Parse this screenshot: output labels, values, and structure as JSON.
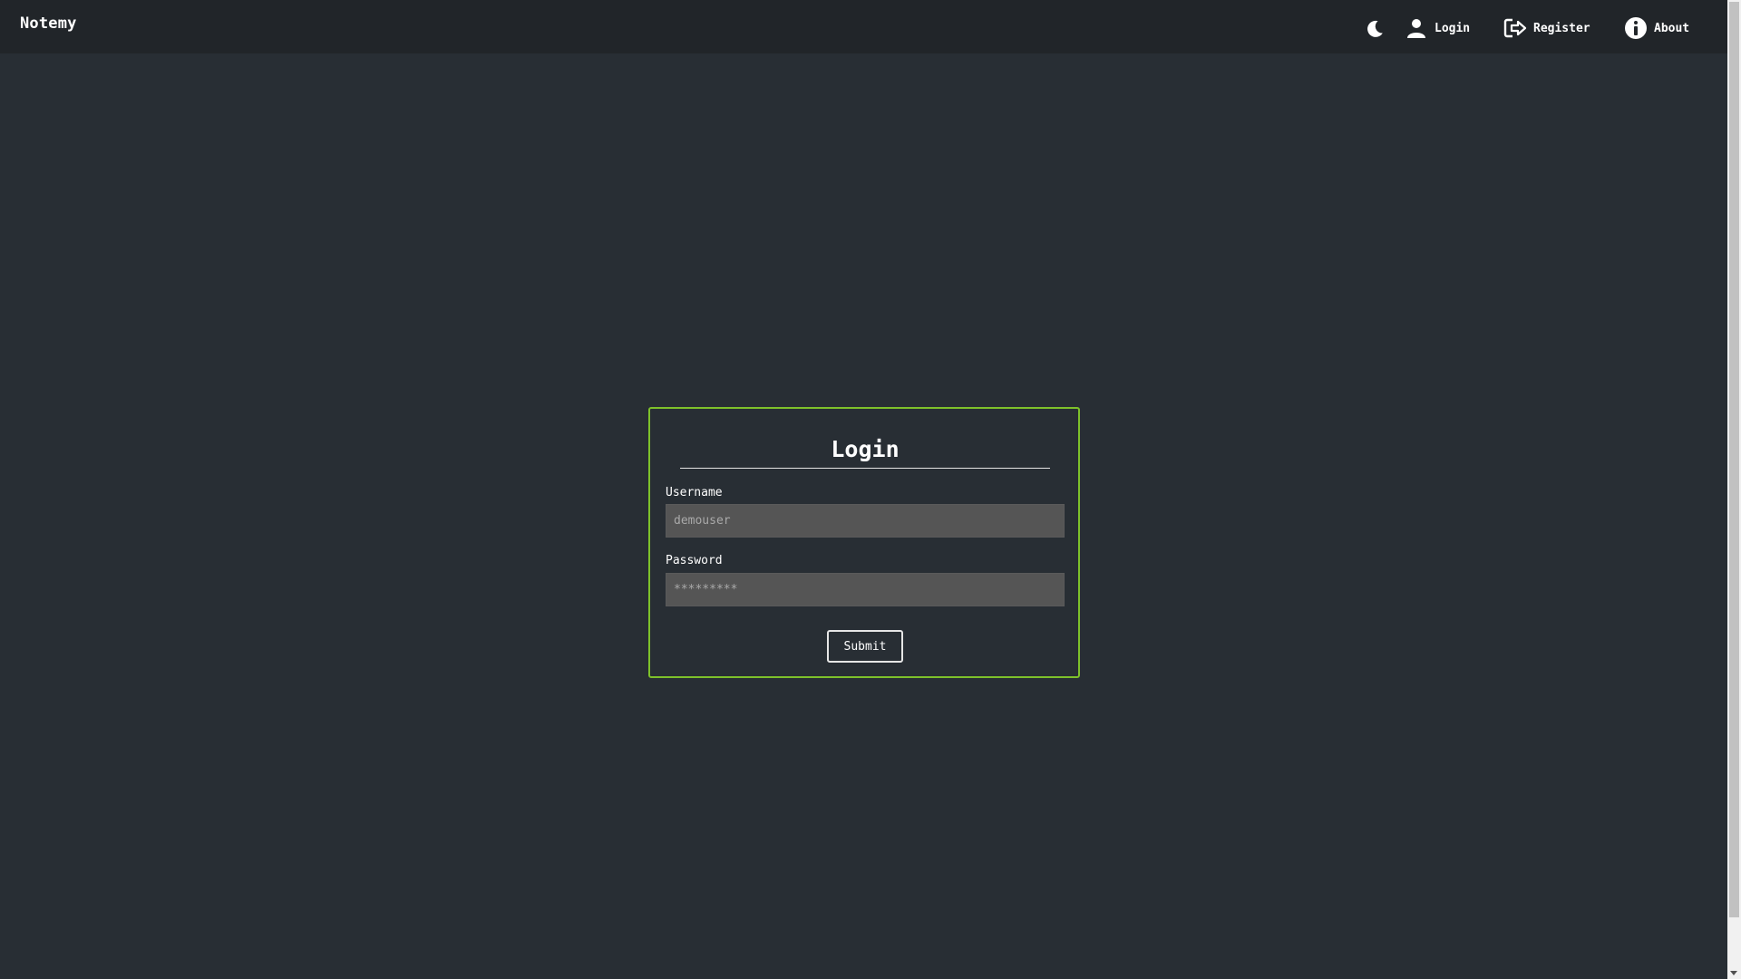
{
  "navbar": {
    "brand": "Notemy",
    "theme_toggle_icon": "moon-icon",
    "links": {
      "login": {
        "label": "Login",
        "icon": "user-icon"
      },
      "register": {
        "label": "Register",
        "icon": "sign-in-icon"
      },
      "about": {
        "label": "About",
        "icon": "info-icon"
      }
    }
  },
  "login_form": {
    "title": "Login",
    "username": {
      "label": "Username",
      "placeholder": "demouser",
      "value": ""
    },
    "password": {
      "label": "Password",
      "placeholder": "*********",
      "value": ""
    },
    "submit_label": "Submit"
  },
  "colors": {
    "page_bg": "#282e34",
    "navbar_bg": "#212529",
    "card_border": "#7ec12a",
    "input_bg": "#555555"
  }
}
